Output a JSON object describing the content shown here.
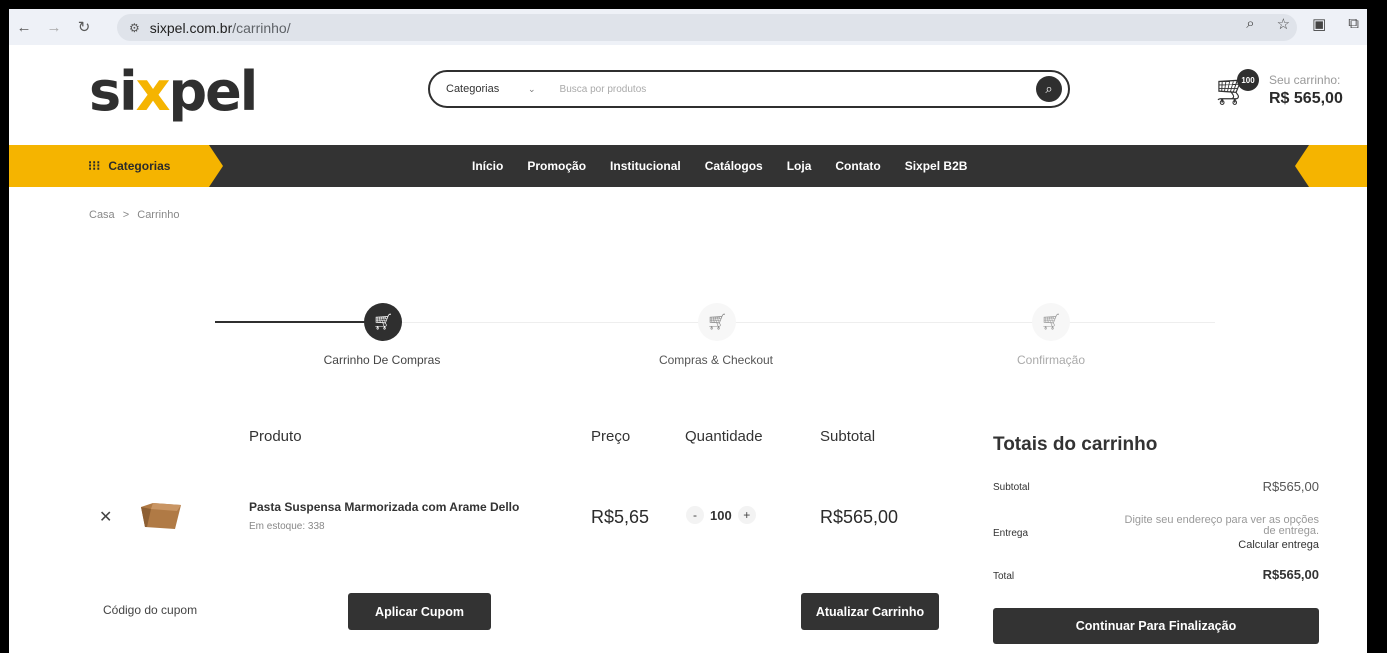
{
  "browser": {
    "url_domain": "sixpel.com.br",
    "url_path": "/carrinho/"
  },
  "header": {
    "logo_part1": "si",
    "logo_x": "x",
    "logo_part2": "pel",
    "search_category": "Categorias",
    "search_placeholder": "Busca por produtos",
    "cart_count": "100",
    "cart_label": "Seu carrinho:",
    "cart_total": "R$ 565,00"
  },
  "nav": {
    "categories_label": "Categorias",
    "links": [
      "Início",
      "Promoção",
      "Institucional",
      "Catálogos",
      "Loja",
      "Contato",
      "Sixpel B2B"
    ]
  },
  "breadcrumb": {
    "home": "Casa",
    "separator": ">",
    "current": "Carrinho"
  },
  "steps": [
    {
      "label": "Carrinho De Compras",
      "state": "active"
    },
    {
      "label": "Compras & Checkout",
      "state": "pending"
    },
    {
      "label": "Confirmação",
      "state": "pending"
    }
  ],
  "cart_table": {
    "headers": {
      "product": "Produto",
      "price": "Preço",
      "quantity": "Quantidade",
      "subtotal": "Subtotal"
    },
    "items": [
      {
        "name": "Pasta Suspensa Marmorizada com Arame Dello",
        "stock": "Em estoque: 338",
        "price": "R$5,65",
        "quantity": "100",
        "subtotal": "R$565,00"
      }
    ],
    "coupon_label": "Código do cupom",
    "apply_coupon": "Aplicar Cupom",
    "update_cart": "Atualizar Carrinho"
  },
  "totals": {
    "title": "Totais do carrinho",
    "subtotal_label": "Subtotal",
    "subtotal_value": "R$565,00",
    "shipping_label": "Entrega",
    "shipping_note": "Digite seu endereço para ver as opções de entrega.",
    "shipping_calc": "Calcular entrega",
    "total_label": "Total",
    "total_value": "R$565,00",
    "checkout_button": "Continuar Para Finalização"
  },
  "colors": {
    "accent": "#f5b400",
    "dark": "#333333"
  }
}
